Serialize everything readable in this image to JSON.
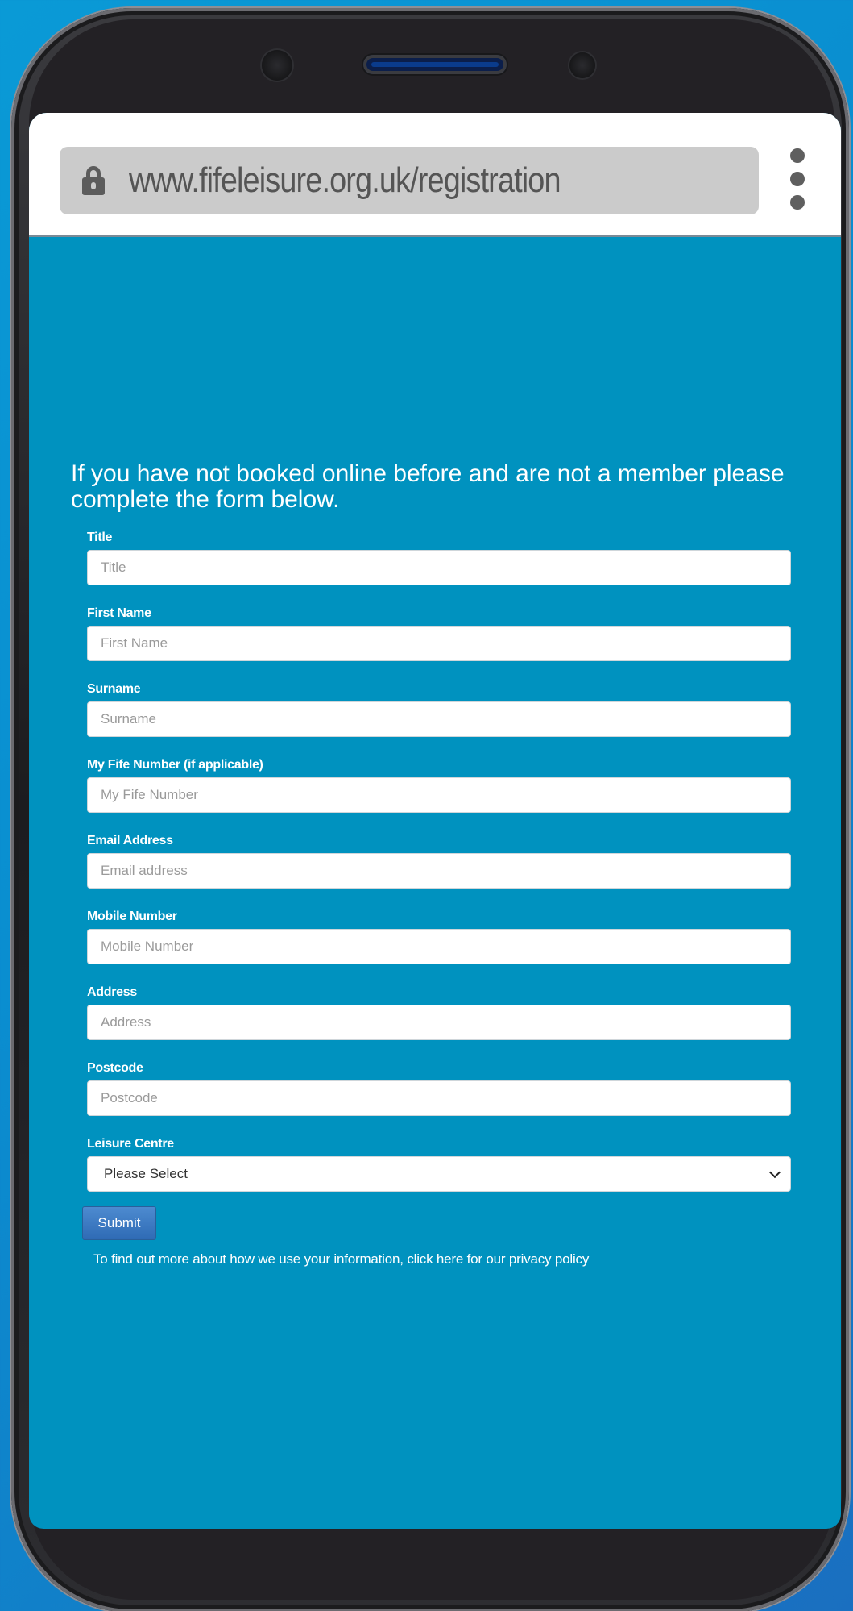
{
  "browser": {
    "url": "www.fifeleisure.org.uk/registration",
    "menu_icon": "more-vert-icon",
    "lock_icon": "lock-icon"
  },
  "page": {
    "intro_text": "If you have not booked online before and are not a member please complete the form below."
  },
  "form": {
    "fields": [
      {
        "label": "Title",
        "placeholder": "Title"
      },
      {
        "label": "First Name",
        "placeholder": "First Name"
      },
      {
        "label": "Surname",
        "placeholder": "Surname"
      },
      {
        "label": "My Fife Number (if applicable)",
        "placeholder": "My Fife Number"
      },
      {
        "label": "Email Address",
        "placeholder": "Email address"
      },
      {
        "label": "Mobile Number",
        "placeholder": "Mobile Number"
      },
      {
        "label": "Address",
        "placeholder": "Address"
      },
      {
        "label": "Postcode",
        "placeholder": "Postcode"
      }
    ],
    "leisure_centre": {
      "label": "Leisure Centre",
      "selected": "Please Select"
    },
    "submit_label": "Submit",
    "privacy_text": "To find out more about how we use your information, click here for our privacy policy"
  },
  "colors": {
    "page_background": "#0092bf",
    "url_bar": "#cbcbcb",
    "submit_button": "#3a77c0"
  }
}
